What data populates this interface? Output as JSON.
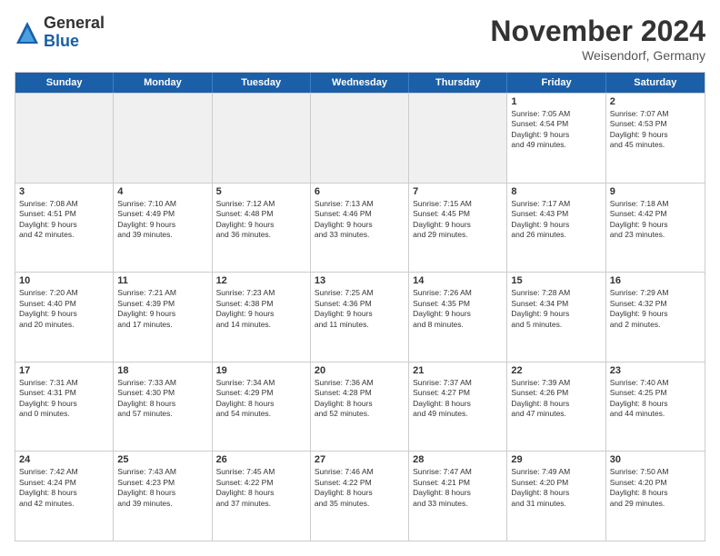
{
  "logo": {
    "general": "General",
    "blue": "Blue"
  },
  "title": "November 2024",
  "location": "Weisendorf, Germany",
  "days": [
    "Sunday",
    "Monday",
    "Tuesday",
    "Wednesday",
    "Thursday",
    "Friday",
    "Saturday"
  ],
  "rows": [
    [
      {
        "day": "",
        "text": ""
      },
      {
        "day": "",
        "text": ""
      },
      {
        "day": "",
        "text": ""
      },
      {
        "day": "",
        "text": ""
      },
      {
        "day": "",
        "text": ""
      },
      {
        "day": "1",
        "text": "Sunrise: 7:05 AM\nSunset: 4:54 PM\nDaylight: 9 hours\nand 49 minutes."
      },
      {
        "day": "2",
        "text": "Sunrise: 7:07 AM\nSunset: 4:53 PM\nDaylight: 9 hours\nand 45 minutes."
      }
    ],
    [
      {
        "day": "3",
        "text": "Sunrise: 7:08 AM\nSunset: 4:51 PM\nDaylight: 9 hours\nand 42 minutes."
      },
      {
        "day": "4",
        "text": "Sunrise: 7:10 AM\nSunset: 4:49 PM\nDaylight: 9 hours\nand 39 minutes."
      },
      {
        "day": "5",
        "text": "Sunrise: 7:12 AM\nSunset: 4:48 PM\nDaylight: 9 hours\nand 36 minutes."
      },
      {
        "day": "6",
        "text": "Sunrise: 7:13 AM\nSunset: 4:46 PM\nDaylight: 9 hours\nand 33 minutes."
      },
      {
        "day": "7",
        "text": "Sunrise: 7:15 AM\nSunset: 4:45 PM\nDaylight: 9 hours\nand 29 minutes."
      },
      {
        "day": "8",
        "text": "Sunrise: 7:17 AM\nSunset: 4:43 PM\nDaylight: 9 hours\nand 26 minutes."
      },
      {
        "day": "9",
        "text": "Sunrise: 7:18 AM\nSunset: 4:42 PM\nDaylight: 9 hours\nand 23 minutes."
      }
    ],
    [
      {
        "day": "10",
        "text": "Sunrise: 7:20 AM\nSunset: 4:40 PM\nDaylight: 9 hours\nand 20 minutes."
      },
      {
        "day": "11",
        "text": "Sunrise: 7:21 AM\nSunset: 4:39 PM\nDaylight: 9 hours\nand 17 minutes."
      },
      {
        "day": "12",
        "text": "Sunrise: 7:23 AM\nSunset: 4:38 PM\nDaylight: 9 hours\nand 14 minutes."
      },
      {
        "day": "13",
        "text": "Sunrise: 7:25 AM\nSunset: 4:36 PM\nDaylight: 9 hours\nand 11 minutes."
      },
      {
        "day": "14",
        "text": "Sunrise: 7:26 AM\nSunset: 4:35 PM\nDaylight: 9 hours\nand 8 minutes."
      },
      {
        "day": "15",
        "text": "Sunrise: 7:28 AM\nSunset: 4:34 PM\nDaylight: 9 hours\nand 5 minutes."
      },
      {
        "day": "16",
        "text": "Sunrise: 7:29 AM\nSunset: 4:32 PM\nDaylight: 9 hours\nand 2 minutes."
      }
    ],
    [
      {
        "day": "17",
        "text": "Sunrise: 7:31 AM\nSunset: 4:31 PM\nDaylight: 9 hours\nand 0 minutes."
      },
      {
        "day": "18",
        "text": "Sunrise: 7:33 AM\nSunset: 4:30 PM\nDaylight: 8 hours\nand 57 minutes."
      },
      {
        "day": "19",
        "text": "Sunrise: 7:34 AM\nSunset: 4:29 PM\nDaylight: 8 hours\nand 54 minutes."
      },
      {
        "day": "20",
        "text": "Sunrise: 7:36 AM\nSunset: 4:28 PM\nDaylight: 8 hours\nand 52 minutes."
      },
      {
        "day": "21",
        "text": "Sunrise: 7:37 AM\nSunset: 4:27 PM\nDaylight: 8 hours\nand 49 minutes."
      },
      {
        "day": "22",
        "text": "Sunrise: 7:39 AM\nSunset: 4:26 PM\nDaylight: 8 hours\nand 47 minutes."
      },
      {
        "day": "23",
        "text": "Sunrise: 7:40 AM\nSunset: 4:25 PM\nDaylight: 8 hours\nand 44 minutes."
      }
    ],
    [
      {
        "day": "24",
        "text": "Sunrise: 7:42 AM\nSunset: 4:24 PM\nDaylight: 8 hours\nand 42 minutes."
      },
      {
        "day": "25",
        "text": "Sunrise: 7:43 AM\nSunset: 4:23 PM\nDaylight: 8 hours\nand 39 minutes."
      },
      {
        "day": "26",
        "text": "Sunrise: 7:45 AM\nSunset: 4:22 PM\nDaylight: 8 hours\nand 37 minutes."
      },
      {
        "day": "27",
        "text": "Sunrise: 7:46 AM\nSunset: 4:22 PM\nDaylight: 8 hours\nand 35 minutes."
      },
      {
        "day": "28",
        "text": "Sunrise: 7:47 AM\nSunset: 4:21 PM\nDaylight: 8 hours\nand 33 minutes."
      },
      {
        "day": "29",
        "text": "Sunrise: 7:49 AM\nSunset: 4:20 PM\nDaylight: 8 hours\nand 31 minutes."
      },
      {
        "day": "30",
        "text": "Sunrise: 7:50 AM\nSunset: 4:20 PM\nDaylight: 8 hours\nand 29 minutes."
      }
    ]
  ]
}
